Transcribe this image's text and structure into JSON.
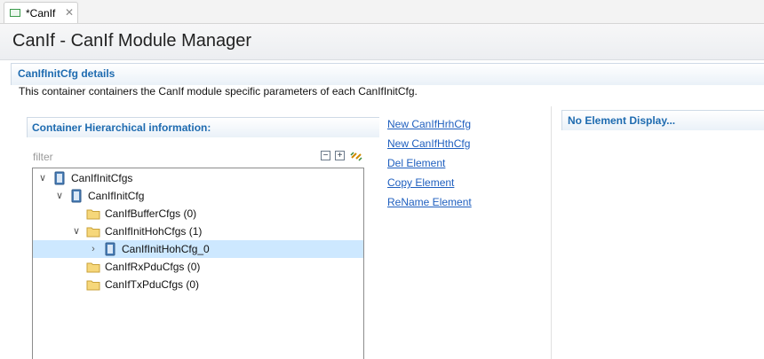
{
  "editor_tab": {
    "title": "*CanIf",
    "icon": "module-file-icon",
    "close_icon": "close-icon"
  },
  "page": {
    "title": "CanIf - CanIf Module Manager"
  },
  "details": {
    "title": "CanIfInitCfg details",
    "description": "This container containers the CanIf module specific parameters of each CanIfInitCfg."
  },
  "hierarchy": {
    "title": "Container Hierarchical information:",
    "filter_placeholder": "filter",
    "toolbar": {
      "collapse_all": "−",
      "expand_all": "+",
      "sync_icon": "link-sync-icon"
    },
    "tree": [
      {
        "label": "CanIfInitCfgs",
        "icon": "container-icon",
        "expanded": true
      },
      {
        "label": "CanIfInitCfg",
        "icon": "container-icon",
        "expanded": true
      },
      {
        "label": "CanIfBufferCfgs (0)",
        "icon": "folder-icon",
        "expanded": false
      },
      {
        "label": "CanIfInitHohCfgs (1)",
        "icon": "folder-icon",
        "expanded": true
      },
      {
        "label": "CanIfInitHohCfg_0",
        "icon": "container-icon",
        "expanded": false,
        "selected": true
      },
      {
        "label": "CanIfRxPduCfgs (0)",
        "icon": "folder-icon",
        "expanded": false
      },
      {
        "label": "CanIfTxPduCfgs (0)",
        "icon": "folder-icon",
        "expanded": false
      }
    ]
  },
  "actions": [
    "New CanIfHrhCfg",
    "New CanIfHthCfg",
    "Del Element",
    "Copy Element",
    "ReName Element"
  ],
  "display": {
    "title": "No Element Display..."
  },
  "colors": {
    "section_title": "#1e6bb0",
    "link": "#1f5fbf",
    "selection": "#cde8ff"
  }
}
